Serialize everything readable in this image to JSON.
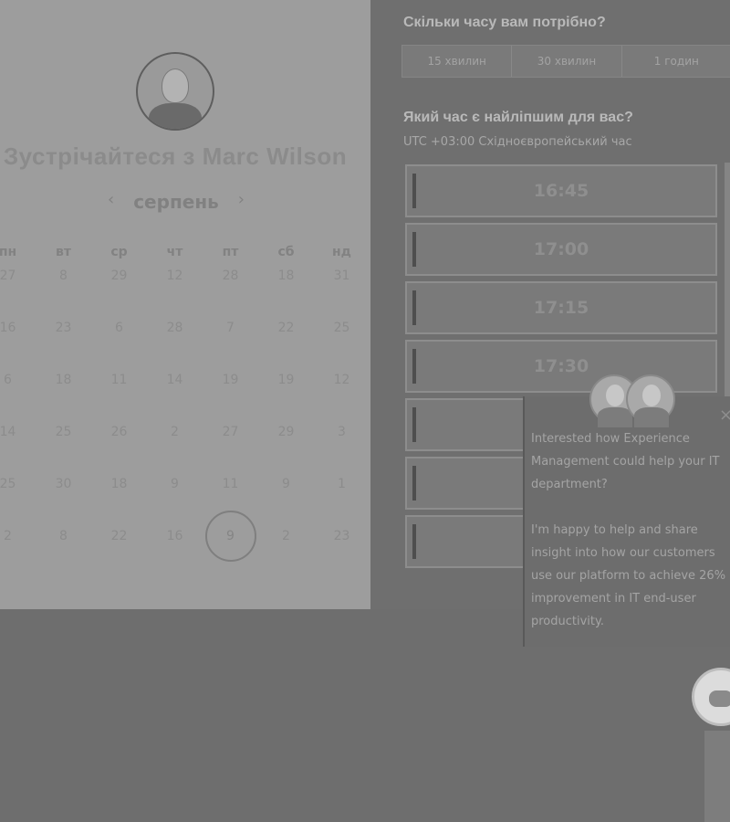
{
  "calendar": {
    "title": "Зустрічайтеся з Marc Wilson",
    "month": "серпень",
    "prev_icon": "‹",
    "next_icon": "›",
    "weekdays": [
      "пн",
      "вт",
      "ср",
      "чт",
      "пт",
      "сб",
      "нд"
    ],
    "weeks": [
      [
        "27",
        "8",
        "29",
        "12",
        "28",
        "18",
        "31"
      ],
      [
        "16",
        "23",
        "6",
        "28",
        "7",
        "22",
        "25"
      ],
      [
        "6",
        "18",
        "11",
        "14",
        "19",
        "19",
        "12"
      ],
      [
        "14",
        "25",
        "26",
        "2",
        "27",
        "29",
        "3"
      ],
      [
        "25",
        "30",
        "18",
        "9",
        "11",
        "9",
        "1"
      ],
      [
        "2",
        "8",
        "22",
        "16",
        "9",
        "2",
        "23"
      ]
    ],
    "selected_day": "9"
  },
  "duration": {
    "question": "Скільки часу вам потрібно?",
    "options": [
      "15 хвилин",
      "30 хвилин",
      "1 годин"
    ]
  },
  "time": {
    "question": "Який час є найліпшим для вас?",
    "timezone": "UTC +03:00 Східноєвропейський час",
    "slots": [
      "16:45",
      "17:00",
      "17:15",
      "17:30",
      "",
      "",
      ""
    ]
  },
  "chat": {
    "message_1": "Interested how Experience Management could help your IT department?",
    "message_2": "I'm happy to help and share insight into how our customers use our platform to achieve 26% improvement in IT end-user productivity.",
    "close_icon": "×"
  }
}
